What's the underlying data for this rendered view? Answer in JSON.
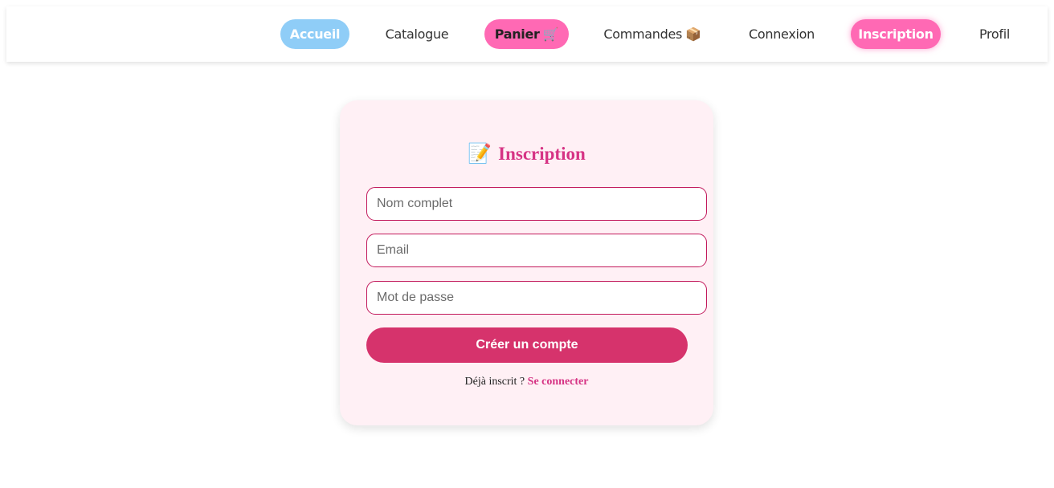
{
  "nav": {
    "items": [
      {
        "label": "Accueil"
      },
      {
        "label": "Catalogue"
      },
      {
        "label": "Panier",
        "icon": "cart-icon",
        "emoji": "🛒"
      },
      {
        "label": "Commandes",
        "icon": "package-icon",
        "emoji": "📦"
      },
      {
        "label": "Connexion"
      },
      {
        "label": "Inscription"
      },
      {
        "label": "Profil"
      }
    ]
  },
  "form": {
    "title": "Inscription",
    "title_icon": "memo-icon",
    "title_emoji": "📝",
    "name_placeholder": "Nom complet",
    "email_placeholder": "Email",
    "password_placeholder": "Mot de passe",
    "submit_label": "Créer un compte",
    "footer_text": "Déjà inscrit ? ",
    "footer_link": "Se connecter"
  },
  "colors": {
    "accent_pink": "#ff69b4",
    "accent_blue": "#8fcdf7",
    "brand": "#d63384",
    "card_bg": "#fff0f5"
  }
}
